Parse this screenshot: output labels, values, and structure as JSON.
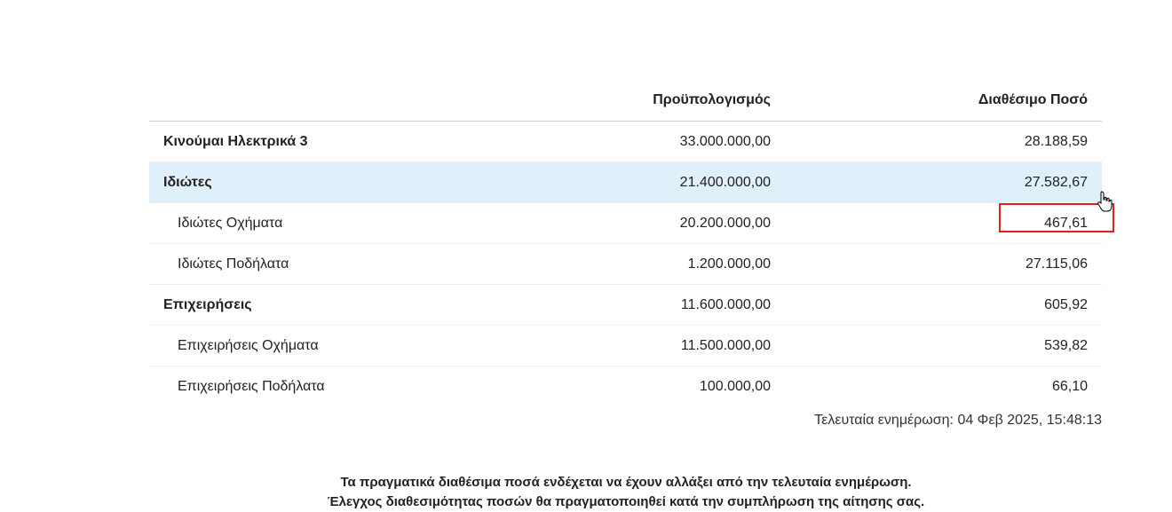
{
  "table": {
    "headers": {
      "name": "",
      "budget": "Προϋπολογισμός",
      "available": "Διαθέσιμο Ποσό"
    },
    "rows": [
      {
        "name": "Κινούμαι Ηλεκτρικά 3",
        "budget": "33.000.000,00",
        "available": "28.188,59"
      },
      {
        "name": "Ιδιώτες",
        "budget": "21.400.000,00",
        "available": "27.582,67"
      },
      {
        "name": "Ιδιώτες Οχήματα",
        "budget": "20.200.000,00",
        "available": "467,61"
      },
      {
        "name": "Ιδιώτες Ποδήλατα",
        "budget": "1.200.000,00",
        "available": "27.115,06"
      },
      {
        "name": "Επιχειρήσεις",
        "budget": "11.600.000,00",
        "available": "605,92"
      },
      {
        "name": "Επιχειρήσεις Οχήματα",
        "budget": "11.500.000,00",
        "available": "539,82"
      },
      {
        "name": "Επιχειρήσεις Ποδήλατα",
        "budget": "100.000,00",
        "available": "66,10"
      }
    ]
  },
  "last_updated": "Τελευταία ενημέρωση: 04 Φεβ 2025, 15:48:13",
  "footer": {
    "line1": "Τα πραγματικά διαθέσιμα ποσά ενδέχεται να έχουν αλλάξει από την τελευταία ενημέρωση.",
    "line2": "Έλεγχος διαθεσιμότητας ποσών θα πραγματοποιηθεί κατά την συμπλήρωση της αίτησης σας."
  },
  "colors": {
    "highlight_row": "#e0f0fb",
    "annotation_box": "#e0201c"
  },
  "icons": {
    "cursor": "hand-pointer-icon"
  }
}
